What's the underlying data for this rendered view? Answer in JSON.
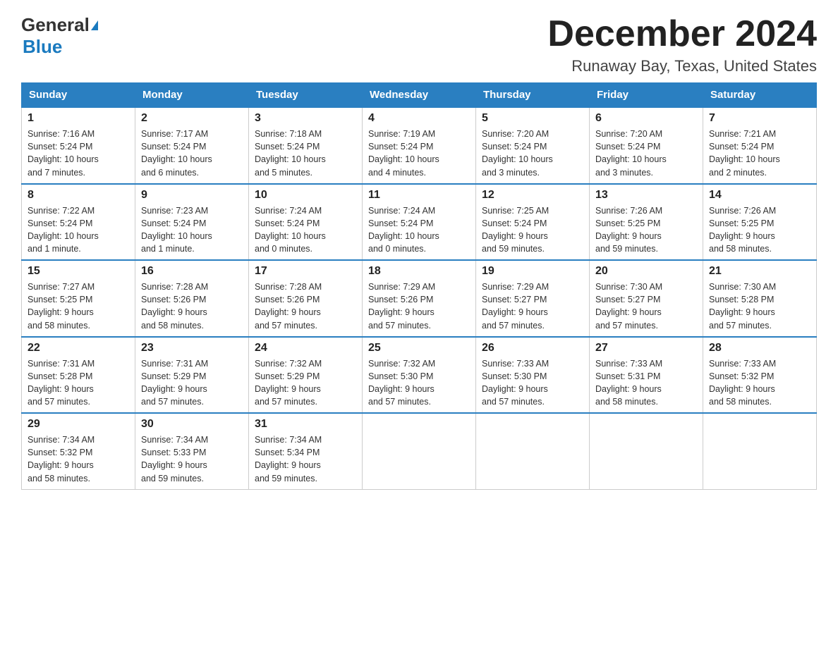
{
  "logo": {
    "general": "General",
    "blue": "Blue"
  },
  "title": "December 2024",
  "location": "Runaway Bay, Texas, United States",
  "weekdays": [
    "Sunday",
    "Monday",
    "Tuesday",
    "Wednesday",
    "Thursday",
    "Friday",
    "Saturday"
  ],
  "weeks": [
    [
      {
        "day": "1",
        "info": "Sunrise: 7:16 AM\nSunset: 5:24 PM\nDaylight: 10 hours\nand 7 minutes."
      },
      {
        "day": "2",
        "info": "Sunrise: 7:17 AM\nSunset: 5:24 PM\nDaylight: 10 hours\nand 6 minutes."
      },
      {
        "day": "3",
        "info": "Sunrise: 7:18 AM\nSunset: 5:24 PM\nDaylight: 10 hours\nand 5 minutes."
      },
      {
        "day": "4",
        "info": "Sunrise: 7:19 AM\nSunset: 5:24 PM\nDaylight: 10 hours\nand 4 minutes."
      },
      {
        "day": "5",
        "info": "Sunrise: 7:20 AM\nSunset: 5:24 PM\nDaylight: 10 hours\nand 3 minutes."
      },
      {
        "day": "6",
        "info": "Sunrise: 7:20 AM\nSunset: 5:24 PM\nDaylight: 10 hours\nand 3 minutes."
      },
      {
        "day": "7",
        "info": "Sunrise: 7:21 AM\nSunset: 5:24 PM\nDaylight: 10 hours\nand 2 minutes."
      }
    ],
    [
      {
        "day": "8",
        "info": "Sunrise: 7:22 AM\nSunset: 5:24 PM\nDaylight: 10 hours\nand 1 minute."
      },
      {
        "day": "9",
        "info": "Sunrise: 7:23 AM\nSunset: 5:24 PM\nDaylight: 10 hours\nand 1 minute."
      },
      {
        "day": "10",
        "info": "Sunrise: 7:24 AM\nSunset: 5:24 PM\nDaylight: 10 hours\nand 0 minutes."
      },
      {
        "day": "11",
        "info": "Sunrise: 7:24 AM\nSunset: 5:24 PM\nDaylight: 10 hours\nand 0 minutes."
      },
      {
        "day": "12",
        "info": "Sunrise: 7:25 AM\nSunset: 5:24 PM\nDaylight: 9 hours\nand 59 minutes."
      },
      {
        "day": "13",
        "info": "Sunrise: 7:26 AM\nSunset: 5:25 PM\nDaylight: 9 hours\nand 59 minutes."
      },
      {
        "day": "14",
        "info": "Sunrise: 7:26 AM\nSunset: 5:25 PM\nDaylight: 9 hours\nand 58 minutes."
      }
    ],
    [
      {
        "day": "15",
        "info": "Sunrise: 7:27 AM\nSunset: 5:25 PM\nDaylight: 9 hours\nand 58 minutes."
      },
      {
        "day": "16",
        "info": "Sunrise: 7:28 AM\nSunset: 5:26 PM\nDaylight: 9 hours\nand 58 minutes."
      },
      {
        "day": "17",
        "info": "Sunrise: 7:28 AM\nSunset: 5:26 PM\nDaylight: 9 hours\nand 57 minutes."
      },
      {
        "day": "18",
        "info": "Sunrise: 7:29 AM\nSunset: 5:26 PM\nDaylight: 9 hours\nand 57 minutes."
      },
      {
        "day": "19",
        "info": "Sunrise: 7:29 AM\nSunset: 5:27 PM\nDaylight: 9 hours\nand 57 minutes."
      },
      {
        "day": "20",
        "info": "Sunrise: 7:30 AM\nSunset: 5:27 PM\nDaylight: 9 hours\nand 57 minutes."
      },
      {
        "day": "21",
        "info": "Sunrise: 7:30 AM\nSunset: 5:28 PM\nDaylight: 9 hours\nand 57 minutes."
      }
    ],
    [
      {
        "day": "22",
        "info": "Sunrise: 7:31 AM\nSunset: 5:28 PM\nDaylight: 9 hours\nand 57 minutes."
      },
      {
        "day": "23",
        "info": "Sunrise: 7:31 AM\nSunset: 5:29 PM\nDaylight: 9 hours\nand 57 minutes."
      },
      {
        "day": "24",
        "info": "Sunrise: 7:32 AM\nSunset: 5:29 PM\nDaylight: 9 hours\nand 57 minutes."
      },
      {
        "day": "25",
        "info": "Sunrise: 7:32 AM\nSunset: 5:30 PM\nDaylight: 9 hours\nand 57 minutes."
      },
      {
        "day": "26",
        "info": "Sunrise: 7:33 AM\nSunset: 5:30 PM\nDaylight: 9 hours\nand 57 minutes."
      },
      {
        "day": "27",
        "info": "Sunrise: 7:33 AM\nSunset: 5:31 PM\nDaylight: 9 hours\nand 58 minutes."
      },
      {
        "day": "28",
        "info": "Sunrise: 7:33 AM\nSunset: 5:32 PM\nDaylight: 9 hours\nand 58 minutes."
      }
    ],
    [
      {
        "day": "29",
        "info": "Sunrise: 7:34 AM\nSunset: 5:32 PM\nDaylight: 9 hours\nand 58 minutes."
      },
      {
        "day": "30",
        "info": "Sunrise: 7:34 AM\nSunset: 5:33 PM\nDaylight: 9 hours\nand 59 minutes."
      },
      {
        "day": "31",
        "info": "Sunrise: 7:34 AM\nSunset: 5:34 PM\nDaylight: 9 hours\nand 59 minutes."
      },
      null,
      null,
      null,
      null
    ]
  ]
}
